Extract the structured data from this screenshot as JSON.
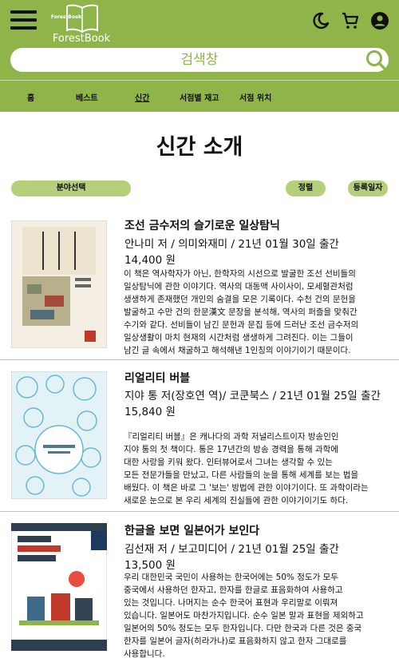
{
  "header": {
    "logo_text": "ForestBook",
    "logo_inner_text": "ForestBook",
    "icons": [
      "menu-icon",
      "moon-icon",
      "cart-icon",
      "account-icon",
      "search-icon"
    ],
    "search_placeholder": "검색창"
  },
  "nav": {
    "items": [
      {
        "label": "홈"
      },
      {
        "label": "베스트"
      },
      {
        "label": "신간"
      },
      {
        "label": "서점별 재고"
      },
      {
        "label": "서점 위치"
      }
    ],
    "active": "신간"
  },
  "page_title": "신간 소개",
  "filters": {
    "category": "분야선택",
    "sort": "정렬",
    "order": "등록일자"
  },
  "books": [
    {
      "title": "조선 금수저의 슬기로운 일상탐닉",
      "meta": "안나미 저 / 의미와재미 / 21년 01월 30일 출간",
      "price": "14,400 원",
      "description": "이 책은 역사학자가 아닌, 한학자의 시선으로 발굴한 조선 선비들의\n일상탐닉에 관한 이야기다. 역사의 대동맥 사이사이, 모세혈관처럼\n생생하게 존재했던 개인의 숨결을 모은 기록이다. 수천 건의 문헌을\n발굴하고 수만 건의 한문漢文 문장을 분석해, 역사의 퍼즐을 맞춰간\n수기와 같다. 선비들이 남긴 문헌과 문집 등에 드러난 조선 금수저의\n일상생활이 마치 현재의 시간처럼 생생하게 그려진다. 이는 그들이\n남긴 글 속에서 채굴하고 해석해낸 1인칭의 이야기이기 때문이다.",
      "cover_text": "조선 금수저의 슬기로운 일상탐닉"
    },
    {
      "title": "리얼리티 버블",
      "meta": "지야 통 저(장호연 역)/ 코쿤북스 / 21년 01월 25일 출간",
      "price": "15,840 원",
      "description": "『리얼리티 버블』은 캐나다의 과학 저널리스트이자 방송인인\n지야 통의 첫 책이다. 통은 17년간의 방송 경력을 통해 과학에\n대한 사랑을 키워 왔다. 인터뷰어로서 그녀는 생각할 수 있는\n모든 전문가들을 만났고, 다른 사람들의 눈을 통해 세계를 보는 법을\n배웠다. 이 책은 바로 그 '보는' 방법에 관한 이야기이다. 또 과학이라는\n새로운 눈으로 본 우리 세계의 진실들에 관한 이야기이기도 하다.",
      "cover_text": "리얼리티 버블"
    },
    {
      "title": "한글을 보면 일본어가 보인다",
      "meta": "김선재 저 / 보고미디어 / 21년 01월 25일 출간",
      "price": "13,500 원",
      "description": "우리 대한민국 국민이 사용하는 한국어에는 50% 정도가 모두\n중국에서 사용하던 한자고, 한자를 한글로 표음화하여 사용하고\n있는 것입니다. 나머지는 순수 한국어 표현과 우리말로 이뤄져\n있습니다. 일본어도 마찬가지입니다. 순수 일본 말과 표현을 제외하고\n일본어의 50% 정도는 모두 한자입니다. 다만 한국과 다른 것은 중국\n한자를 일본어 글자(히라가나)로 표음화하지 않고 한자 그대로를\n사용합니다.",
      "cover_text": "한글을 보면 일본어가 보인다"
    }
  ],
  "colors": {
    "brand": "#8fb54a",
    "pill": "#b5d07a",
    "divider": "#bfbfbf"
  }
}
